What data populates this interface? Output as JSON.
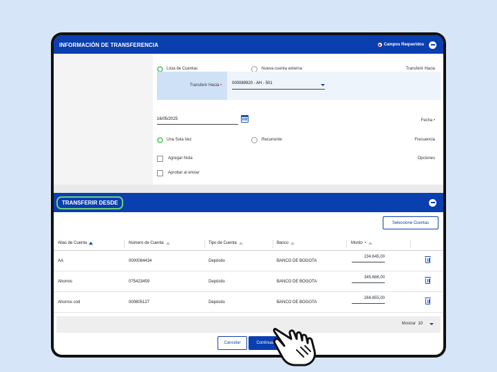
{
  "transfer_info": {
    "title": "INFORMACIÓN DE TRANSFERENCIA",
    "required_label": "Campos Requeridos",
    "transferir_hacia_label": "Transferir Hacia",
    "option_lista": "Lista de Cuentas",
    "option_nueva": "Nueva cuenta externa",
    "sub_label": "Transferir Hacia",
    "selected_account": "000089920 - AH - 501",
    "fecha_label": "Fecha",
    "fecha_value": "16/05/2025",
    "frecuencia_label": "Frecuencia",
    "freq_option_once": "Una Sola Vez",
    "freq_option_recurrent": "Recurrente",
    "opciones_label": "Opciones",
    "opt_note": "Agregar Nota",
    "opt_approve": "Aprobar al enviar"
  },
  "transfer_from": {
    "title": "TRANSFERIR DESDE",
    "select_button": "Seleccione Cuentas",
    "columns": {
      "alias": "Alias de Cuenta",
      "numero": "Número de Cuenta",
      "tipo": "Tipo de Cuenta",
      "banco": "Banco",
      "monto": "Monto"
    },
    "rows": [
      {
        "alias": "AA",
        "numero": "0000084434",
        "tipo": "Depósito",
        "banco": "BANCO DE BOGOTA",
        "monto": "234.645,00"
      },
      {
        "alias": "Ahorros",
        "numero": "075423459",
        "tipo": "Depósito",
        "banco": "BANCO DE BOGOTA",
        "monto": "345.686,00"
      },
      {
        "alias": "Ahorros cod",
        "numero": "000805127",
        "tipo": "Depósito",
        "banco": "BANCO DE BOGOTA",
        "monto": "266.855,00"
      }
    ],
    "mostrar_label": "Mostrar",
    "mostrar_value": "10"
  },
  "actions": {
    "cancel": "Cancelar",
    "continue": "Continuar"
  },
  "colors": {
    "primary": "#0a3fb0",
    "highlight": "#6fd07c",
    "required": "#dd1111"
  }
}
